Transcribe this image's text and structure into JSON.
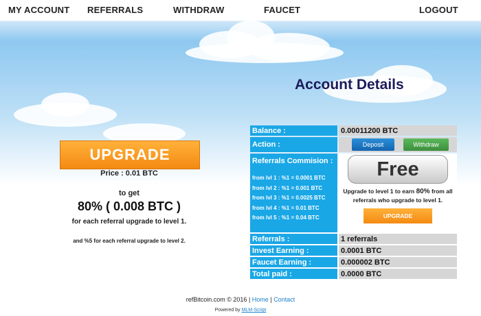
{
  "nav": {
    "my_account": "MY ACCOUNT",
    "referrals": "REFERRALS",
    "withdraw": "WITHDRAW",
    "faucet": "FAUCET",
    "logout": "LOGOUT"
  },
  "page_title": "Account Details",
  "upgrade_panel": {
    "button": "UPGRADE",
    "price": "Price : 0.01 BTC",
    "to_get": "to get",
    "percent": "80% ( 0.008 BTC )",
    "each": "for each referral upgrade to level 1.",
    "second": "and %5 for each referral upgrade to level 2."
  },
  "details": {
    "balance_label": "Balance :",
    "balance_value": "0.00011200 BTC",
    "action_label": "Action :",
    "deposit_button": "Deposit",
    "withdraw_button": "Withdraw",
    "commission_label": "Referrals Commision :",
    "levels": [
      "from lvl 1 : %1 = 0.0001 BTC",
      "from lvl 2 : %1 = 0.001 BTC",
      "from lvl 3 : %1 = 0.0025 BTC",
      "from lvl 4 : %1 = 0.01 BTC",
      "from lvl 5 : %1 = 0.04 BTC"
    ],
    "free_badge": "Free",
    "free_text_pre": "Upgrade to level 1 to earn ",
    "free_text_pct": "80%",
    "free_text_post": " from all referrals who upgrade to level 1.",
    "upgrade_button": "UPGRADE",
    "referrals_label": "Referrals :",
    "referrals_value": "1 referrals",
    "invest_label": "Invest Earning :",
    "invest_value": "0.0001 BTC",
    "faucet_label": "Faucet Earning :",
    "faucet_value": "0.000002 BTC",
    "total_label": "Total paid :",
    "total_value": "0.0000 BTC"
  },
  "footer": {
    "copyright": "refBitcoin.com © 2016 |",
    "home": "Home",
    "sep": "|",
    "contact": "Contact",
    "powered_by": "Powered by",
    "script": "MLM-Script"
  }
}
